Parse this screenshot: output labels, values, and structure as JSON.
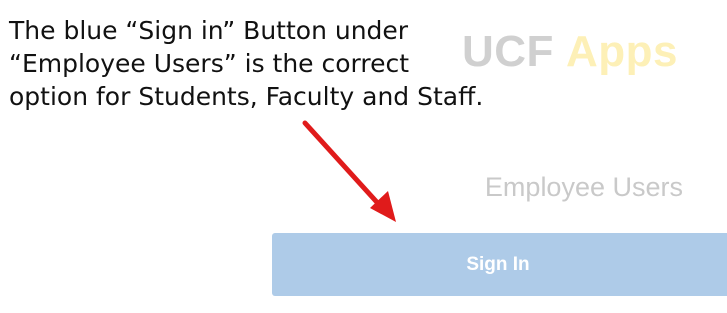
{
  "annotation": {
    "lines": [
      "The blue “Sign in” Button under",
      "“Employee Users” is the correct",
      "option for Students, Faculty and Staff."
    ],
    "arrow_color": "#e01b1b"
  },
  "brand": {
    "ucf": "UCF",
    "apps": "Apps"
  },
  "section": {
    "label": "Employee Users"
  },
  "signin": {
    "label": "Sign In",
    "color": "#aecbe8"
  }
}
